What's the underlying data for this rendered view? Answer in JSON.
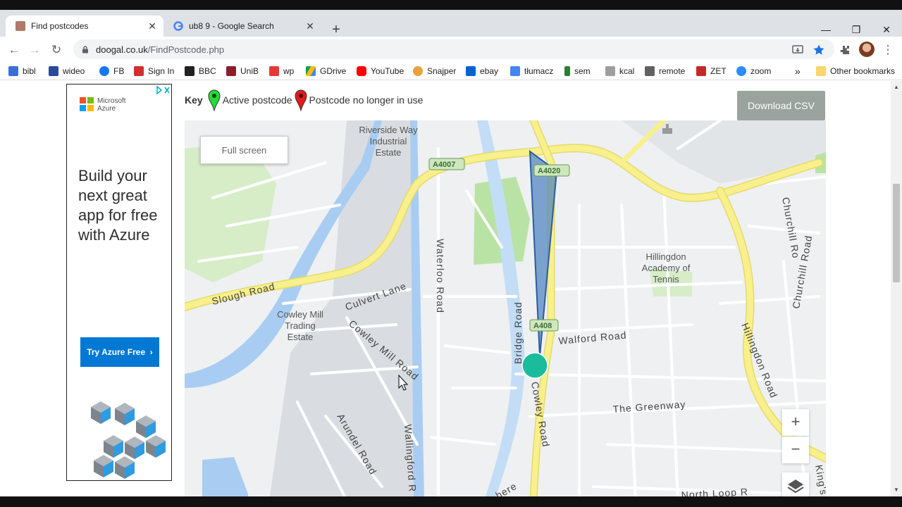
{
  "browser": {
    "tabs": [
      {
        "title": "Find postcodes",
        "active": true
      },
      {
        "title": "ub8 9 - Google Search",
        "active": false
      }
    ],
    "url_host": "doogal.co.uk",
    "url_path": "/FindPostcode.php",
    "bookmarks": [
      "bibl",
      "wideo",
      "FB",
      "Sign In",
      "BBC",
      "UniB",
      "wp",
      "GDrive",
      "YouTube",
      "Snajper",
      "ebay",
      "tłumacz",
      "sem",
      "kcal",
      "remote",
      "ZET",
      "zoom"
    ],
    "other_bookmarks": "Other bookmarks",
    "overflow": "»"
  },
  "ad": {
    "brand_line1": "Microsoft",
    "brand_line2": "Azure",
    "headline": "Build your next great app for free with Azure",
    "cta": "Try Azure Free"
  },
  "key": {
    "label": "Key",
    "active": "Active postcode",
    "inactive": "Postcode no longer in use"
  },
  "download_button": "Download CSV",
  "map": {
    "fullscreen_label": "Full screen",
    "zoom_in": "+",
    "zoom_out": "−",
    "labels": {
      "riverside_1": "Riverside Way",
      "riverside_2": "Industrial",
      "riverside_3": "Estate",
      "a4007": "A4007",
      "a4020": "A4020",
      "a408": "A408",
      "slough": "Slough Road",
      "culvert": "Culvert Lane",
      "cowley_mill_1": "Cowley Mill",
      "cowley_mill_2": "Trading",
      "cowley_mill_3": "Estate",
      "cowley_mill_road": "Cowley Mill Road",
      "waterloo": "Waterloo Road",
      "bridge": "Bridge Road",
      "walford": "Walford Road",
      "greenway": "The Greenway",
      "cowley_road": "Cowley Road",
      "arundel": "Arundel Road",
      "wallingford": "Wallingford R",
      "churchill_1": "Churchill Ro",
      "churchill_2": "Churchill Road",
      "hillingdon_road": "Hillingdon Road",
      "academy_1": "Hillingdon",
      "academy_2": "Academy of",
      "academy_3": "Tennis",
      "north_loop": "North Loop R",
      "kings": "King's",
      "here": "here"
    },
    "colors": {
      "marker": "#1abc9c",
      "polygon": "#4a7fc1",
      "major_road": "#f7f08c",
      "water": "#a9cdf2",
      "park": "#b9e3a4"
    }
  }
}
